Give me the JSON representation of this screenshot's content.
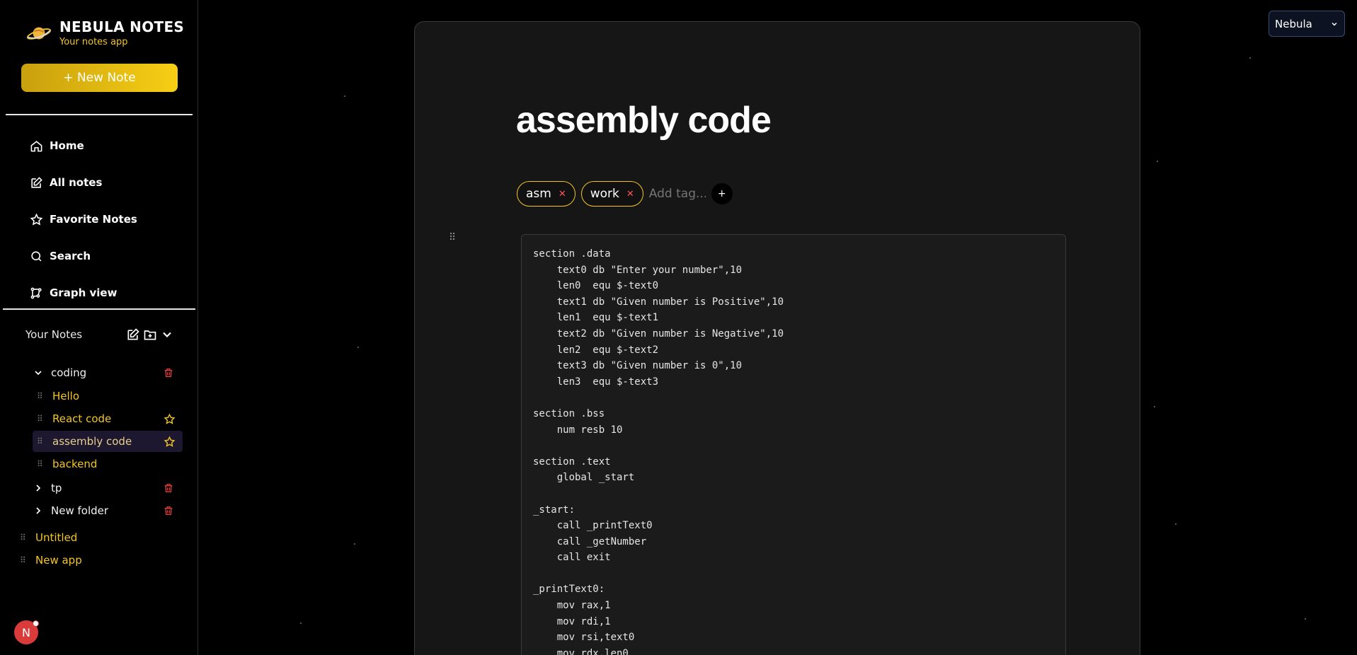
{
  "brand": {
    "title": "NEBULA NOTES",
    "subtitle": "Your notes app"
  },
  "new_note_label": "+ New Note",
  "nav": [
    {
      "label": "Home",
      "icon": "home-icon"
    },
    {
      "label": "All notes",
      "icon": "edit-icon"
    },
    {
      "label": "Favorite Notes",
      "icon": "star-icon"
    },
    {
      "label": "Search",
      "icon": "search-icon"
    },
    {
      "label": "Graph view",
      "icon": "graph-icon"
    }
  ],
  "your_notes": {
    "label": "Your Notes",
    "folders": [
      {
        "name": "coding",
        "expanded": true,
        "notes": [
          {
            "name": "Hello",
            "favorite": false
          },
          {
            "name": "React code",
            "favorite": true
          },
          {
            "name": "assembly code",
            "favorite": true,
            "active": true
          },
          {
            "name": "backend",
            "favorite": false
          }
        ]
      },
      {
        "name": "tp",
        "expanded": false
      },
      {
        "name": "New folder",
        "expanded": false
      }
    ],
    "loose_notes": [
      "Untitled",
      "New app"
    ]
  },
  "avatar_initial": "N",
  "theme": {
    "selected": "Nebula"
  },
  "note": {
    "title": "assembly code",
    "tags": [
      "asm",
      "work"
    ],
    "add_tag_placeholder": "Add tag...",
    "add_tag_button": "+",
    "code": "section .data\n    text0 db \"Enter your number\",10\n    len0  equ $-text0\n    text1 db \"Given number is Positive\",10\n    len1  equ $-text1\n    text2 db \"Given number is Negative\",10\n    len2  equ $-text2\n    text3 db \"Given number is 0\",10\n    len3  equ $-text3\n\nsection .bss\n    num resb 10\n\nsection .text\n    global _start\n\n_start:\n    call _printText0\n    call _getNumber\n    call exit\n\n_printText0:\n    mov rax,1\n    mov rdi,1\n    mov rsi,text0\n    mov rdx,len0"
  },
  "colors": {
    "accent": "#f3c623",
    "danger": "#e03a3a",
    "background": "#000000",
    "card": "#161616"
  }
}
